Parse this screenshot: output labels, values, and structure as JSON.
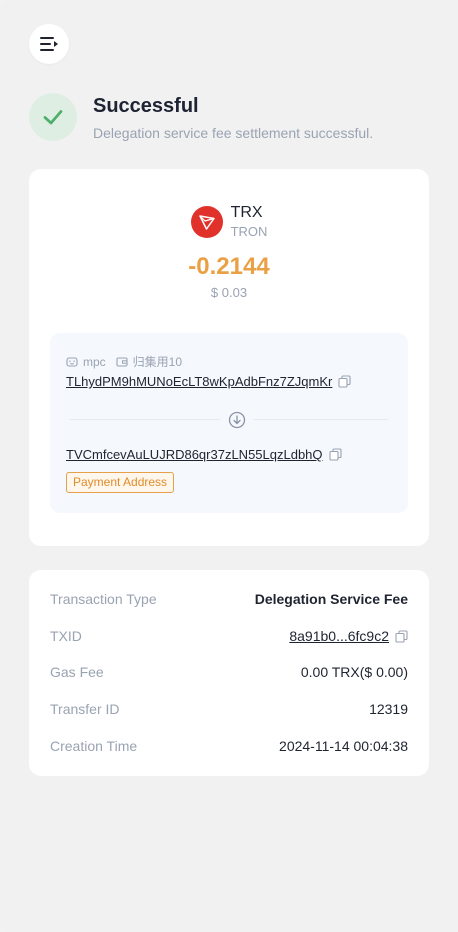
{
  "status": {
    "title": "Successful",
    "message": "Delegation service fee settlement successful.",
    "color": "#4caf6a"
  },
  "asset": {
    "symbol": "TRX",
    "name": "TRON",
    "amount": "-0.2144",
    "fiat": "$ 0.03",
    "logo_icon": "tron-logo-icon",
    "amount_color": "#eaa044"
  },
  "from": {
    "wallet_type": "mpc",
    "wallet_name": "归集用10",
    "address": "TLhydPM9hMUNoEcLT8wKpAdbFnz7ZJqmKr"
  },
  "to": {
    "address": "TVCmfcevAuLUJRD86qr37zLN55LqzLdbhQ",
    "badge": "Payment Address"
  },
  "details": [
    {
      "label": "Transaction Type",
      "value": "Delegation Service Fee"
    },
    {
      "label": "TXID",
      "value": "8a91b0...6fc9c2"
    },
    {
      "label": "Gas Fee",
      "value": "0.00 TRX($ 0.00)"
    },
    {
      "label": "Transfer ID",
      "value": "12319"
    },
    {
      "label": "Creation Time",
      "value": "2024-11-14 00:04:38"
    }
  ]
}
